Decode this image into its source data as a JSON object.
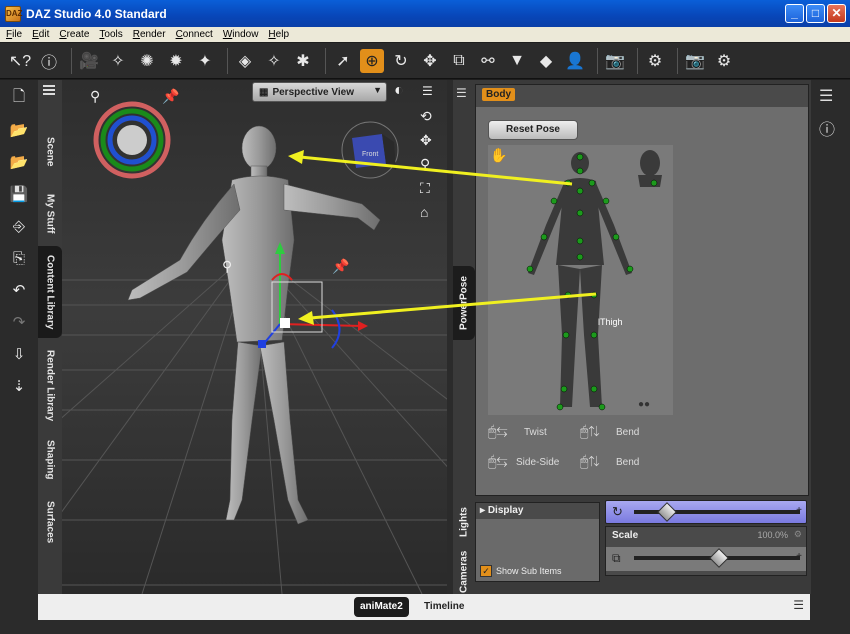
{
  "window": {
    "title": "DAZ Studio 4.0 Standard",
    "app_icon": "DAZ",
    "minimize": "_",
    "maximize": "□",
    "close": "✕"
  },
  "menu": [
    "File",
    "Edit",
    "Create",
    "Tools",
    "Render",
    "Connect",
    "Window",
    "Help"
  ],
  "toolbar_icons": [
    "whats-this-icon",
    "help-icon",
    "camera-new-icon",
    "spotlight-new-icon",
    "point-light-icon",
    "distant-light-icon",
    "light-wand-icon",
    "primitive-icon",
    "figure-add-icon",
    "prop-add-icon",
    "select-icon",
    "universal-tool-icon",
    "rotate-tool-icon",
    "translate-tool-icon",
    "scale-tool-icon",
    "joint-editor-icon",
    "triangle-tool-icon",
    "surface-select-icon",
    "figure-select-icon",
    "render-icon",
    "settings-icon",
    "camera-render-icon",
    "render-settings-icon"
  ],
  "left_tabs": [
    "Scene",
    "My Stuff",
    "Content Library",
    "Render Library",
    "Shaping",
    "Surfaces"
  ],
  "viewport": {
    "view_name": "Perspective View",
    "cube_label": "Front",
    "accent": "#e28f1a"
  },
  "panel_tabs": [
    "PowerPose",
    "Lights",
    "Cameras"
  ],
  "powerpose": {
    "region_label": "Body",
    "reset_label": "Reset Pose",
    "hover_label": "lThigh",
    "legend": {
      "twist": "Twist",
      "bend1": "Bend",
      "sideside": "Side-Side",
      "bend2": "Bend"
    }
  },
  "display": {
    "header": "Display",
    "show_sub_items": "Show Sub Items"
  },
  "params": {
    "scale_label": "Scale",
    "scale_value": "100.0%"
  },
  "bottom_tabs": [
    "aniMate2",
    "Timeline"
  ]
}
